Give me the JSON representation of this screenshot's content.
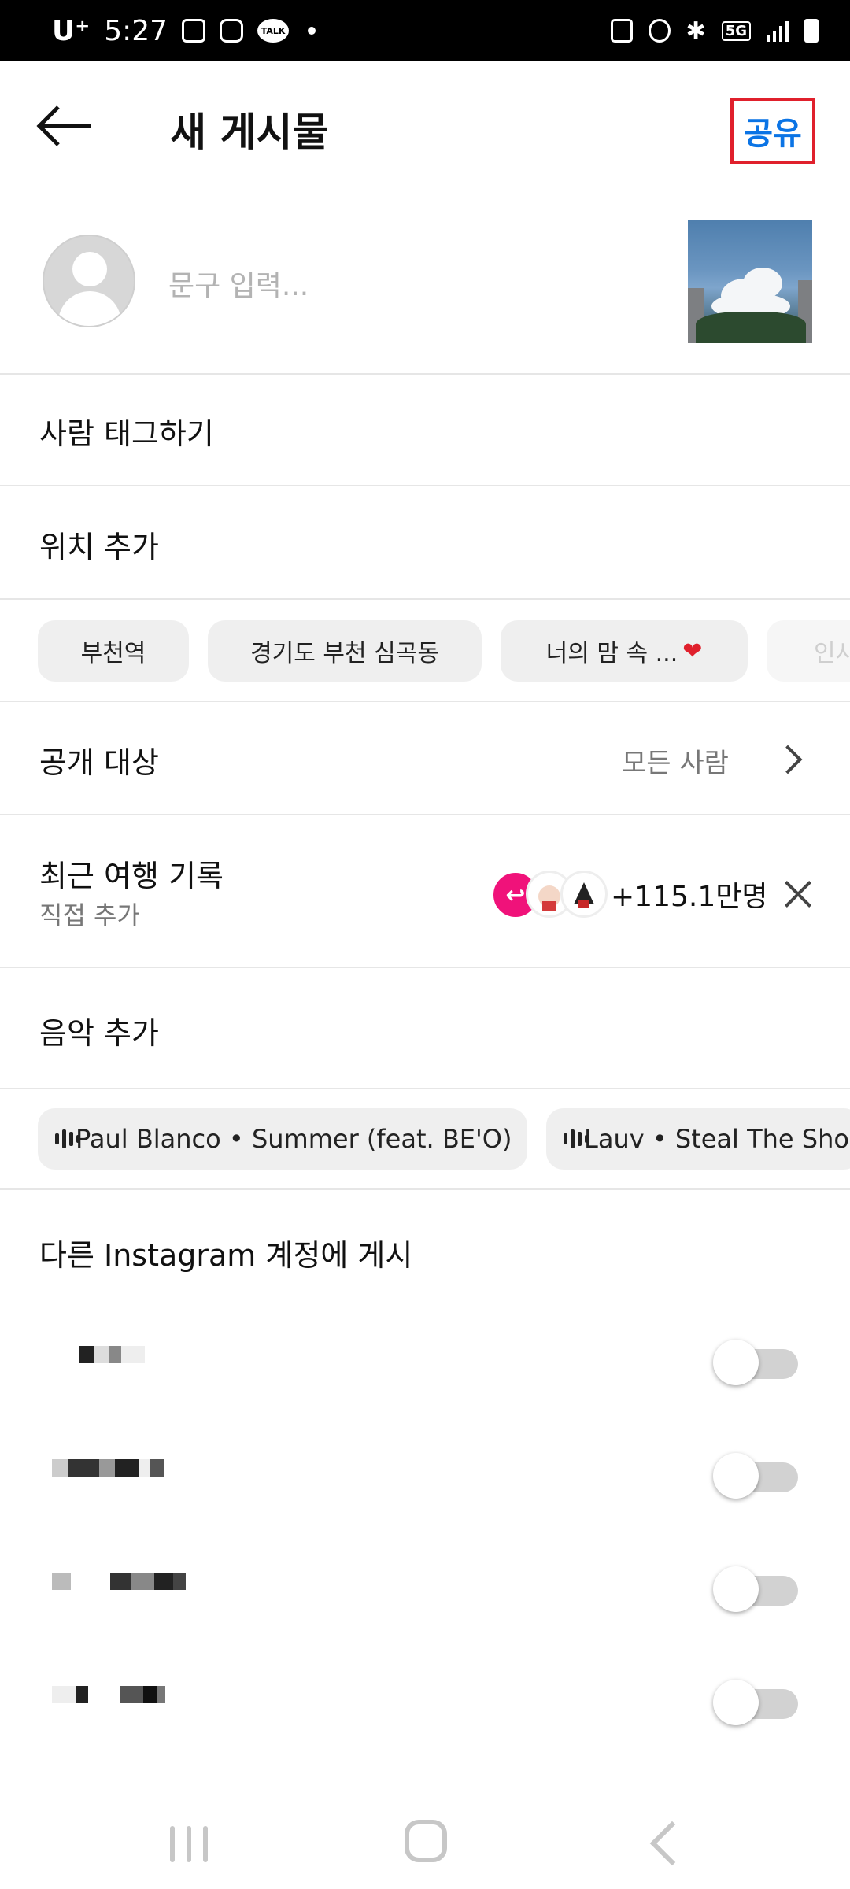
{
  "status_bar": {
    "carrier": "U⁺",
    "time": "5:27",
    "network": "5G"
  },
  "header": {
    "title": "새 게시물",
    "share_label": "공유",
    "back_icon": "arrow-left-icon"
  },
  "caption": {
    "placeholder": "문구 입력..."
  },
  "rows": {
    "tag_people": "사람 태그하기",
    "add_location": "위치 추가"
  },
  "location_chips": [
    "부천역",
    "경기도 부천 심곡동",
    "너의 맘 속 ...",
    "인사"
  ],
  "audience": {
    "label": "공개 대상",
    "value": "모든 사람"
  },
  "travel": {
    "label": "최근 여행 기록",
    "sublabel": "직접 추가",
    "count": "+115.1만명"
  },
  "music": {
    "label": "음악 추가",
    "chips": [
      "Paul Blanco • Summer (feat. BE'O)",
      "Lauv • Steal The Show"
    ]
  },
  "accounts": {
    "title": "다른 Instagram 계정에 게시",
    "items": [
      {
        "enabled": false
      },
      {
        "enabled": false
      },
      {
        "enabled": false
      },
      {
        "enabled": false
      }
    ]
  },
  "colors": {
    "accent": "#0b74e5",
    "highlight_box": "#e0202c",
    "pink": "#f0127a"
  }
}
